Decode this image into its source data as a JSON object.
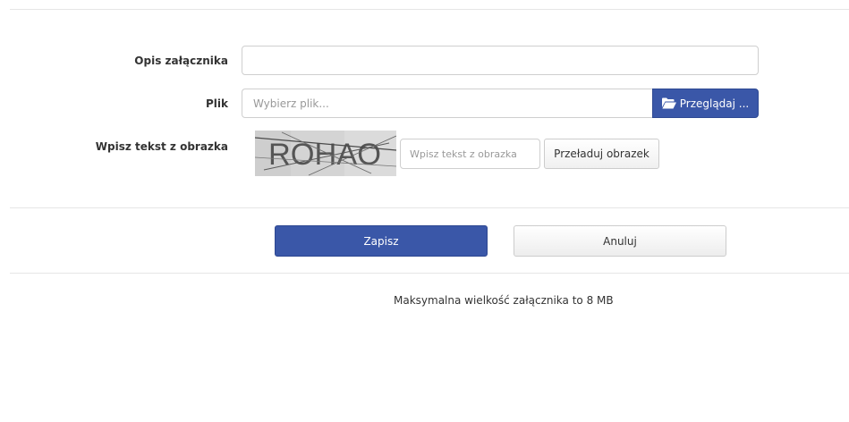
{
  "form": {
    "description": {
      "label": "Opis załącznika",
      "value": "",
      "placeholder": ""
    },
    "file": {
      "label": "Plik",
      "placeholder": "Wybierz plik...",
      "browse_label": "Przeglądaj ...",
      "browse_icon": "folder-open-icon"
    },
    "captcha": {
      "label": "Wpisz tekst z obrazka",
      "image_text": "ROHAO",
      "input_placeholder": "Wpisz tekst z obrazka",
      "reload_label": "Przeładuj obrazek"
    }
  },
  "actions": {
    "save_label": "Zapisz",
    "cancel_label": "Anuluj"
  },
  "note": "Maksymalna wielkość załącznika to 8 MB",
  "colors": {
    "primary": "#3a57a8",
    "border": "#cfcfcf",
    "divider": "#e6e6e6"
  }
}
